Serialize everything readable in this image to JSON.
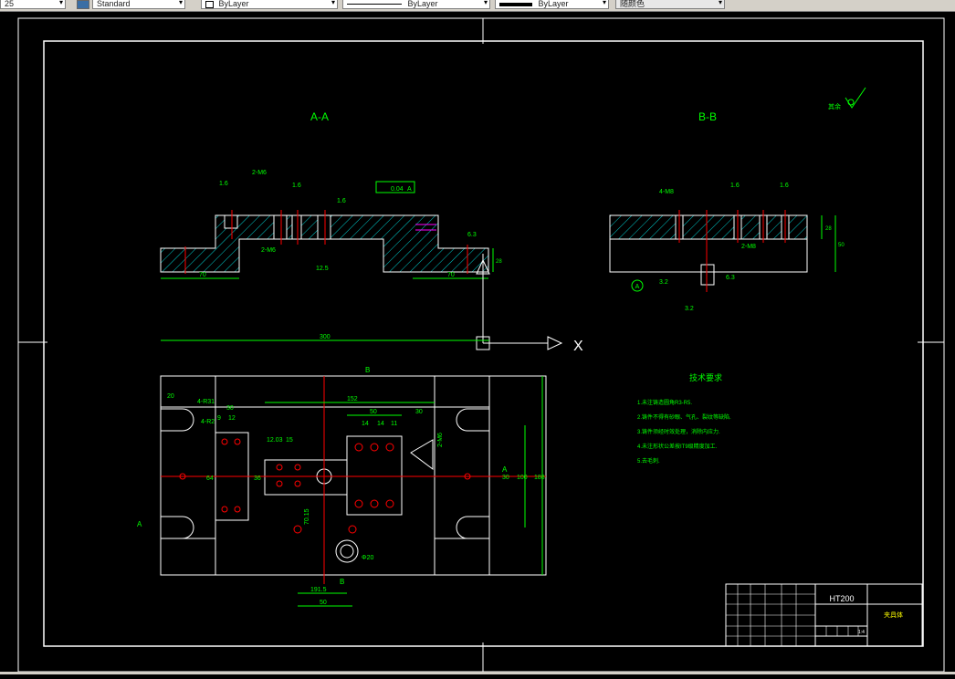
{
  "toolbar": {
    "scale_value": "25",
    "text_style": "Standard",
    "layer_color": "ByLayer",
    "linetype": "ByLayer",
    "lineweight": "ByLayer",
    "plot_style": "随颜色"
  },
  "drawing": {
    "view_aa_label": "A-A",
    "view_bb_label": "B-B",
    "roughness_note": "其余",
    "x_axis_label": "X",
    "tech_req_title": "技术要求",
    "tech_req_items": [
      "1.未注铸造圆角R3-R5.",
      "2.铸件不得有砂眼、气孔、裂纹等缺陷.",
      "3.铸件须经时效处理，消除内应力.",
      "4.未注形状公差按IT9级精度加工.",
      "5.去毛刺."
    ],
    "material": "HT200",
    "part_name": "夹具体",
    "sheet_count": "1:4",
    "dimensions": {
      "overall_length": "300",
      "dim_152": "152",
      "dim_50_top": "50",
      "dim_30_top": "30",
      "dim_20": "20",
      "dim_30_left": "30",
      "dim_9": "9",
      "dim_12": "12",
      "dim_1203": "12.03",
      "dim_15": "15",
      "dim_14a": "14",
      "dim_14b": "14",
      "dim_11": "11",
      "dim_70_aa_left": "70",
      "dim_70_aa_right": "70",
      "dim_r4": "4-R31",
      "dim_4r2": "4-R2",
      "dim_100": "100",
      "dim_188": "188",
      "dim_30_right": "30",
      "dim_50_bottom": "50",
      "dim_1915": "191.5",
      "dim_7015": "70.15",
      "dim_phi20": "Φ20",
      "dim_64": "64",
      "dim_36": "36",
      "dim_2m6": "2-M6",
      "dim_4m8": "4-M8",
      "dim_2m8": "2-M8",
      "ra_16": "1.6",
      "ra_32": "3.2",
      "ra_63": "6.3",
      "ra_125": "12.5",
      "tol_frame": "0.04",
      "datum_a": "A",
      "datum_b": "B",
      "b_dim_28": "28",
      "b_dim_50": "50"
    }
  },
  "colors": {
    "background": "#000000",
    "frame": "#ffffff",
    "dimension": "#00ff00",
    "centerline": "#ff0000",
    "hatch": "#00ffff",
    "geometry": "#ffffff",
    "accent": "#ff00ff",
    "toolbar": "#d4d0c8"
  }
}
